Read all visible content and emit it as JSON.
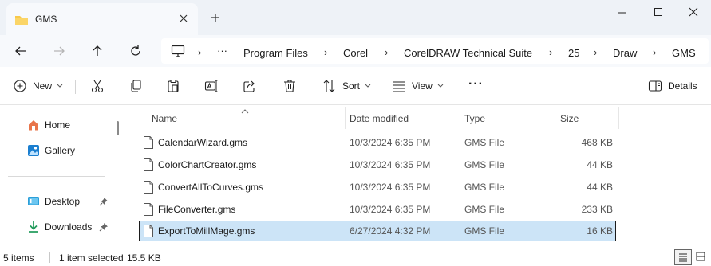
{
  "window": {
    "tab_title": "GMS",
    "colors": {
      "titlebar_bg": "#eef2f7",
      "accent": "#005fb8",
      "selection": "#cce4f7",
      "folder_yellow": "#f8c94a"
    }
  },
  "titlebar": {
    "folder_icon": "folder-icon",
    "close_tab_icon": "close-icon",
    "new_tab_icon": "plus-icon",
    "minimize_icon": "minimize-icon",
    "maximize_icon": "maximize-icon",
    "close_window_icon": "close-icon"
  },
  "nav": {
    "back_icon": "arrow-left-icon",
    "forward_icon": "arrow-right-icon",
    "up_icon": "arrow-up-icon",
    "refresh_icon": "refresh-icon"
  },
  "address": {
    "pc_icon": "monitor-icon",
    "overflow": "···",
    "crumbs": [
      "Program Files",
      "Corel",
      "CorelDRAW Technical Suite",
      "25",
      "Draw",
      "GMS"
    ],
    "separator": "›"
  },
  "toolbar": {
    "new_label": "New",
    "sort_label": "Sort",
    "view_label": "View",
    "more_label": "···",
    "details_label": "Details",
    "icons": [
      "plus-circle-icon",
      "cut-icon",
      "copy-icon",
      "paste-icon",
      "rename-icon",
      "share-icon",
      "delete-icon"
    ]
  },
  "sidebar": {
    "items": [
      {
        "label": "Home",
        "icon": "home-icon",
        "pinned": false
      },
      {
        "label": "Gallery",
        "icon": "gallery-icon",
        "pinned": false
      },
      {
        "label": "Desktop",
        "icon": "desktop-icon",
        "pinned": true
      },
      {
        "label": "Downloads",
        "icon": "download-icon",
        "pinned": true
      }
    ]
  },
  "columns": {
    "name": "Name",
    "date": "Date modified",
    "type": "Type",
    "size": "Size"
  },
  "files": [
    {
      "name": "CalendarWizard.gms",
      "date": "10/3/2024 6:35 PM",
      "type": "GMS File",
      "size": "468 KB",
      "selected": false
    },
    {
      "name": "ColorChartCreator.gms",
      "date": "10/3/2024 6:35 PM",
      "type": "GMS File",
      "size": "44 KB",
      "selected": false
    },
    {
      "name": "ConvertAllToCurves.gms",
      "date": "10/3/2024 6:35 PM",
      "type": "GMS File",
      "size": "44 KB",
      "selected": false
    },
    {
      "name": "FileConverter.gms",
      "date": "10/3/2024 6:35 PM",
      "type": "GMS File",
      "size": "233 KB",
      "selected": false
    },
    {
      "name": "ExportToMillMage.gms",
      "date": "6/27/2024 4:32 PM",
      "type": "GMS File",
      "size": "16 KB",
      "selected": true
    }
  ],
  "status": {
    "item_count": "5 items",
    "selection": "1 item selected",
    "selection_size": "15.5 KB"
  }
}
